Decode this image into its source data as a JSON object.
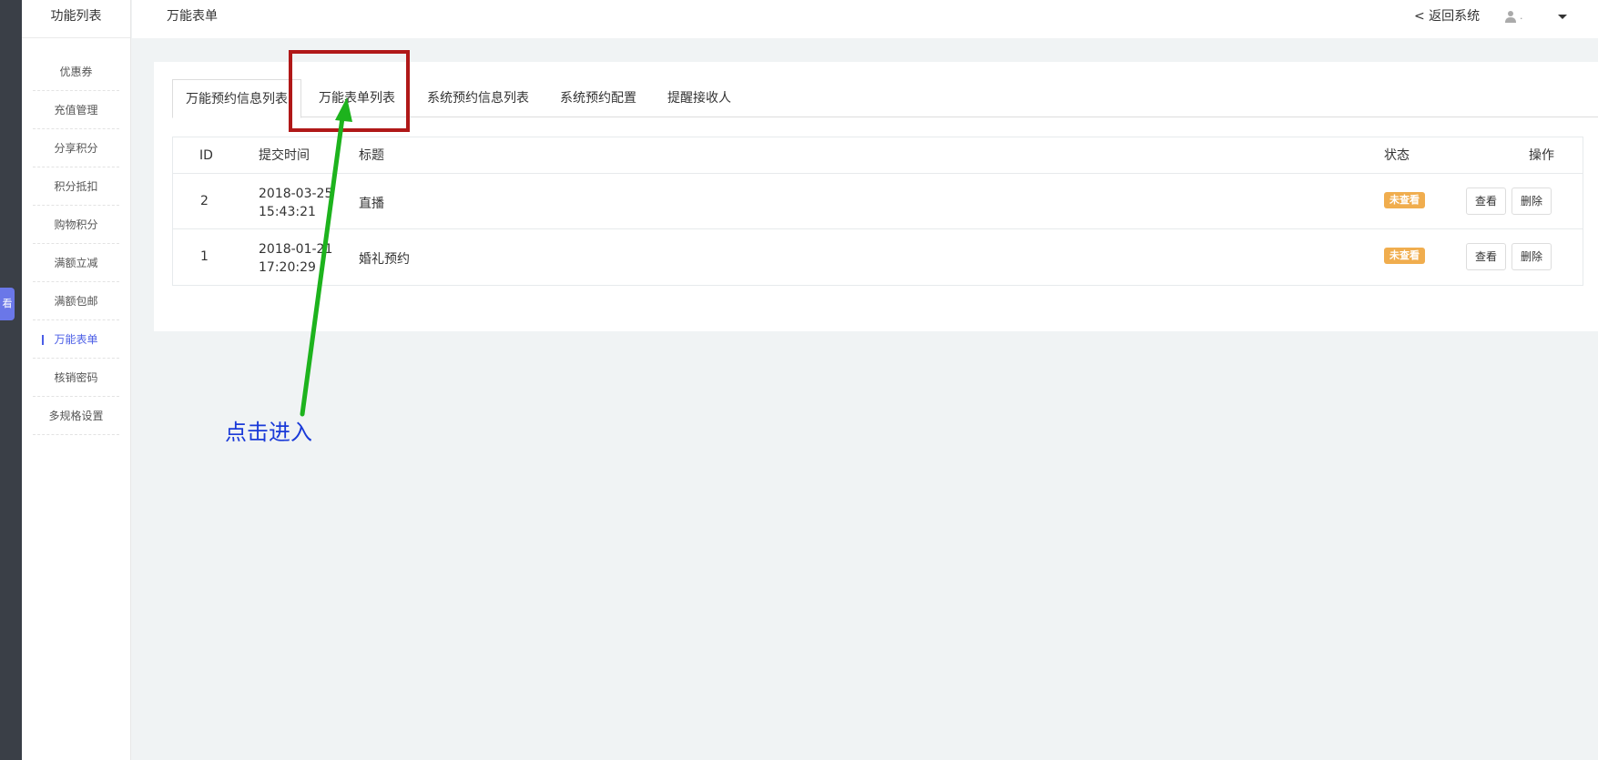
{
  "sidebar": {
    "title": "功能列表",
    "items": [
      {
        "label": "优惠券"
      },
      {
        "label": "充值管理"
      },
      {
        "label": "分享积分"
      },
      {
        "label": "积分抵扣"
      },
      {
        "label": "购物积分"
      },
      {
        "label": "满额立减"
      },
      {
        "label": "满额包邮"
      },
      {
        "label": "万能表单",
        "active": true
      },
      {
        "label": "核销密码"
      },
      {
        "label": "多规格设置"
      }
    ]
  },
  "rail": {
    "tab_label": "看"
  },
  "topbar": {
    "title": "万能表单",
    "back_label": "< 返回系统",
    "user_name": ".",
    "user_icon": "user-icon",
    "dropdown_icon": "caret-down-icon"
  },
  "tabs": [
    {
      "label": "万能预约信息列表",
      "active": true
    },
    {
      "label": "万能表单列表"
    },
    {
      "label": "系统预约信息列表"
    },
    {
      "label": "系统预约配置"
    },
    {
      "label": "提醒接收人"
    }
  ],
  "table": {
    "headers": {
      "id": "ID",
      "time": "提交时间",
      "title": "标题",
      "status": "状态",
      "actions": "操作"
    },
    "rows": [
      {
        "id": "2",
        "date": "2018-03-25",
        "time": "15:43:21",
        "title": "直播",
        "status": "未查看",
        "view": "查看",
        "delete": "删除"
      },
      {
        "id": "1",
        "date": "2018-01-21",
        "time": "17:20:29",
        "title": "婚礼预约",
        "status": "未查看",
        "view": "查看",
        "delete": "删除"
      }
    ]
  },
  "annotation": {
    "text": "点击进入",
    "box_color": "#b01818",
    "arrow_color": "#1db31d",
    "text_color": "#1a3ad8"
  },
  "colors": {
    "accent": "#4a5de6",
    "badge": "#f0ad4e",
    "rail": "#3a3f47"
  }
}
